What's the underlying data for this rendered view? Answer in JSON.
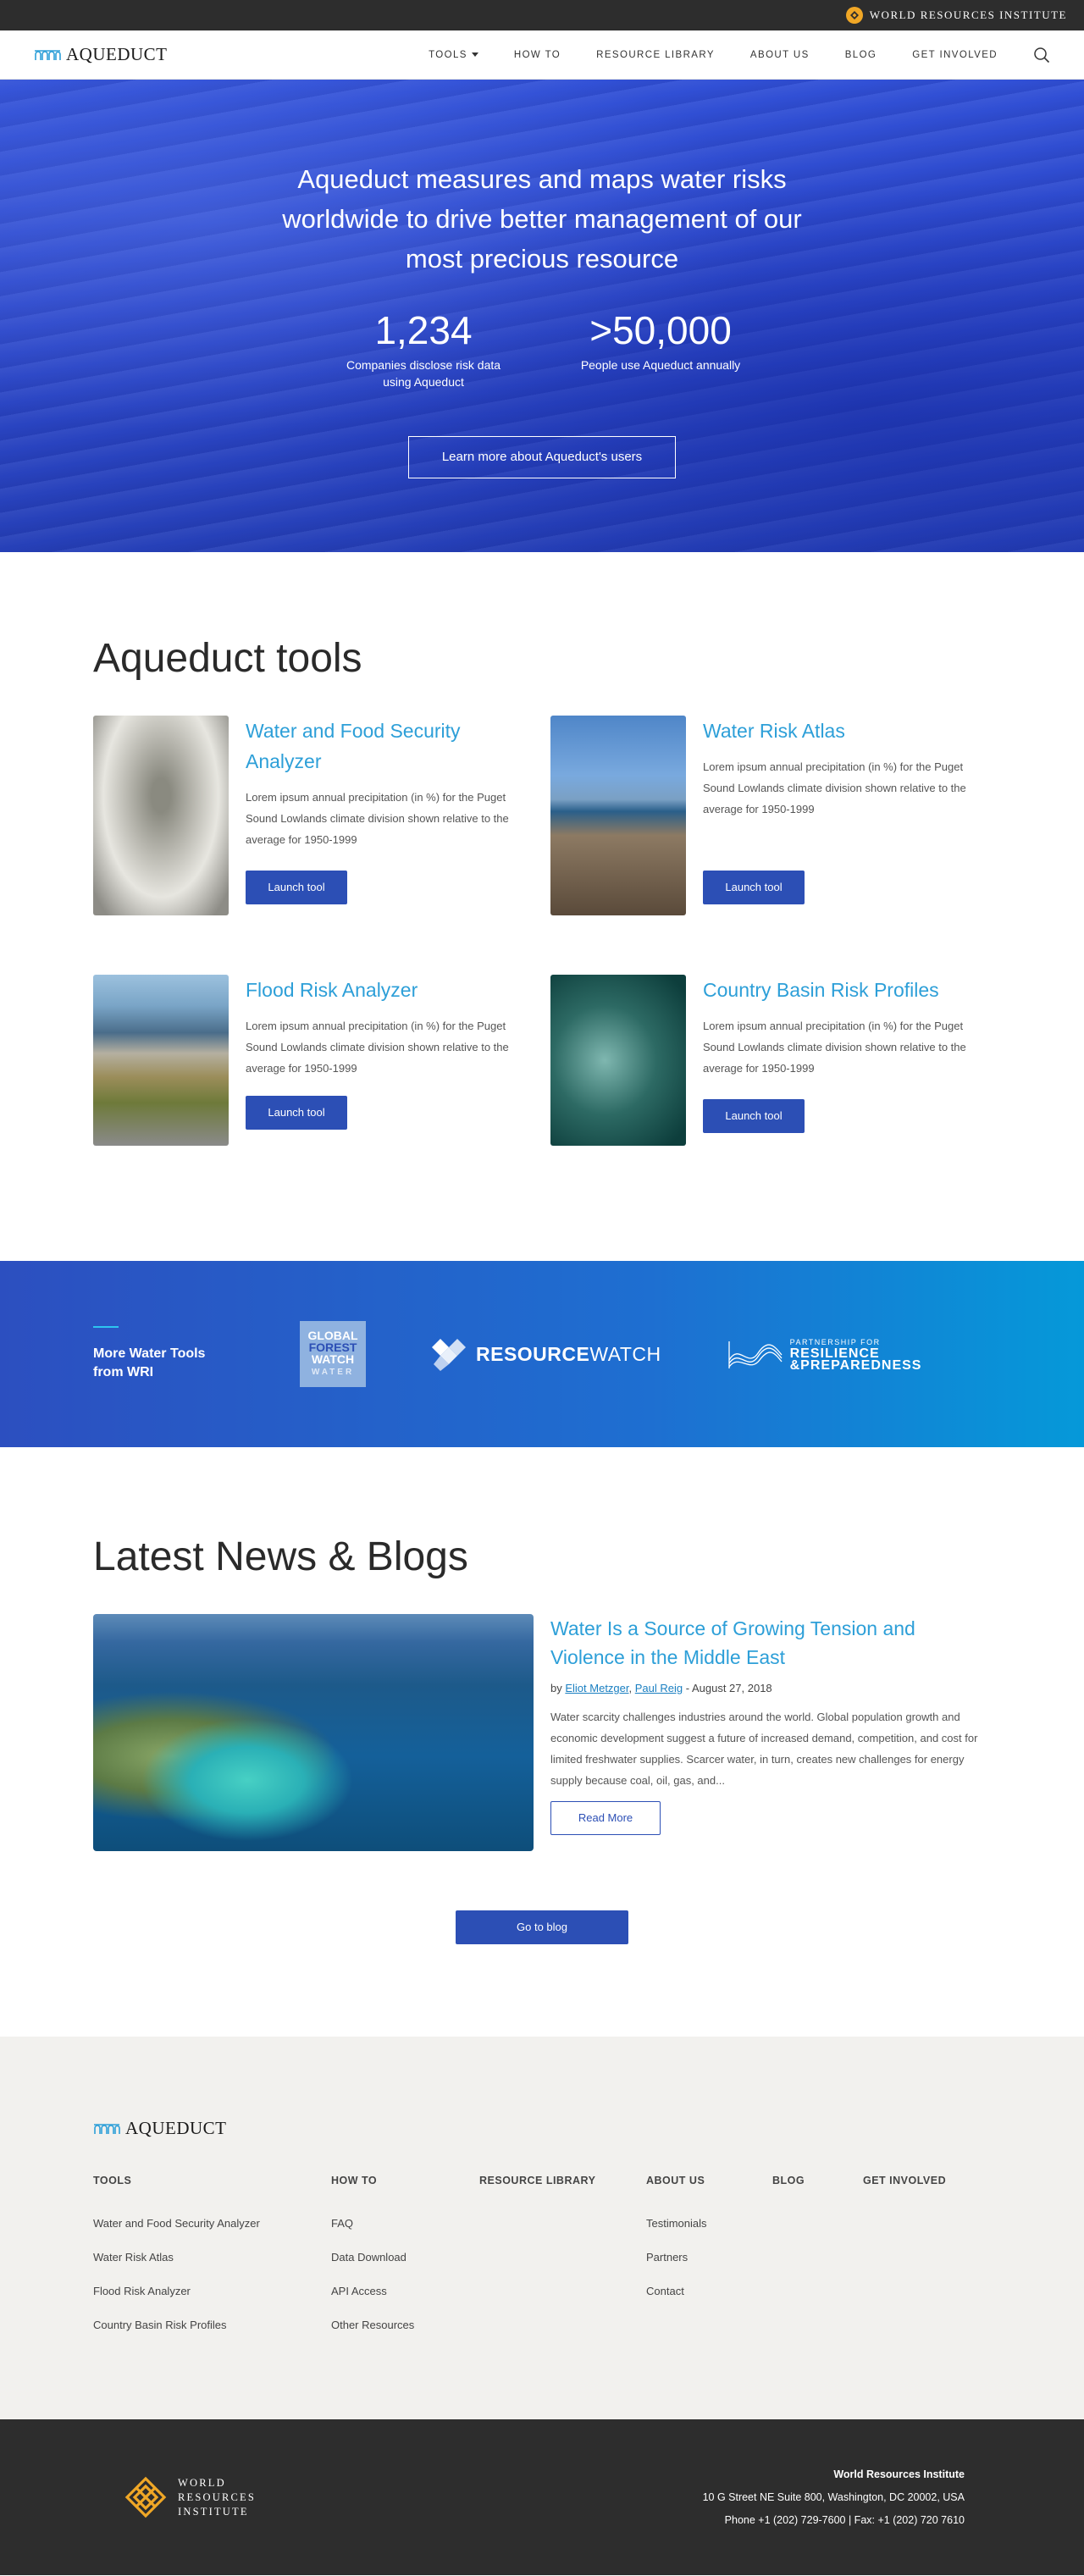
{
  "topbar": {
    "org_name": "WORLD RESOURCES INSTITUTE"
  },
  "header": {
    "brand": "AQUEDUCT",
    "nav": [
      {
        "label": "TOOLS"
      },
      {
        "label": "HOW TO"
      },
      {
        "label": "RESOURCE LIBRARY"
      },
      {
        "label": "ABOUT US"
      },
      {
        "label": "BLOG"
      },
      {
        "label": "GET INVOLVED"
      }
    ]
  },
  "hero": {
    "headline": "Aqueduct measures and maps water risks worldwide to drive better management of our most precious resource",
    "stats": [
      {
        "value": "1,234",
        "label": "Companies disclose risk data using Aqueduct"
      },
      {
        "value": ">50,000",
        "label": "People use Aqueduct annually"
      }
    ],
    "cta": "Learn more about Aqueduct's users"
  },
  "tools": {
    "title": "Aqueduct tools",
    "items": [
      {
        "title": "Water and Food Security Analyzer",
        "description": "Lorem ipsum annual precipitation (in %) for the Puget Sound Lowlands climate division shown relative to the average for 1950-1999",
        "button": "Launch tool"
      },
      {
        "title": "Water Risk Atlas",
        "description": "Lorem ipsum annual precipitation (in %) for the Puget Sound Lowlands climate division shown relative to the average for 1950-1999",
        "button": "Launch tool"
      },
      {
        "title": "Flood Risk Analyzer",
        "description": "Lorem ipsum annual precipitation (in %) for the Puget Sound Lowlands climate division shown relative to the average for 1950-1999",
        "button": "Launch tool"
      },
      {
        "title": "Country Basin Risk Profiles",
        "description": "Lorem ipsum annual precipitation (in %) for the Puget Sound Lowlands climate division shown relative to the average for 1950-1999",
        "button": "Launch tool"
      }
    ]
  },
  "more_tools": {
    "title_line1": "More Water Tools",
    "title_line2": "from WRI",
    "gfw": {
      "line1": "GLOBAL",
      "line2": "FOREST",
      "line3": "WATCH",
      "line4": "WATER"
    },
    "rw": {
      "bold": "RESOURCE",
      "rest": "WATCH"
    },
    "prp": {
      "small": "PARTNERSHIP FOR",
      "line1": "RESILIENCE",
      "line2": "&PREPAREDNESS"
    }
  },
  "news": {
    "title": "Latest News & Blogs",
    "article": {
      "title": "Water Is a Source of Growing Tension and Violence in the Middle East",
      "by": "by",
      "author1": "Eliot Metzger",
      "author2": "Paul Reig",
      "date": " - August 27, 2018",
      "excerpt": "Water scarcity challenges industries around the world. Global population growth and economic development suggest a future of increased demand, competition, and cost for limited freshwater supplies. Scarcer water, in turn, creates new challenges for energy supply because coal, oil, gas, and...",
      "button": "Read More"
    },
    "blog_button": "Go to blog"
  },
  "footer": {
    "brand": "AQUEDUCT",
    "columns": [
      {
        "head": "TOOLS",
        "links": [
          "Water and Food Security Analyzer",
          "Water Risk Atlas",
          "Flood Risk Analyzer",
          "Country Basin Risk Profiles"
        ]
      },
      {
        "head": "HOW TO",
        "links": [
          "FAQ",
          "Data Download",
          "API Access",
          "Other Resources"
        ]
      },
      {
        "head": "RESOURCE LIBRARY",
        "links": []
      },
      {
        "head": "ABOUT US",
        "links": [
          "Testimonials",
          "Partners",
          "Contact"
        ]
      },
      {
        "head": "BLOG",
        "links": []
      },
      {
        "head": "GET INVOLVED",
        "links": []
      }
    ],
    "wri": {
      "line1": "WORLD",
      "line2": "RESOURCES",
      "line3": "INSTITUTE"
    },
    "address": {
      "name": "World Resources Institute",
      "street": "10 G Street NE Suite 800, Washington, DC 20002, USA",
      "phone": "Phone +1 (202) 729-7600 | Fax: +1 (202) 720 7610"
    }
  },
  "colors": {
    "accent": "#2d9fd8",
    "button": "#2c4fb5",
    "hero": "#2c47c9",
    "wri_gold": "#f0a726",
    "dark": "#2d2d2d"
  }
}
